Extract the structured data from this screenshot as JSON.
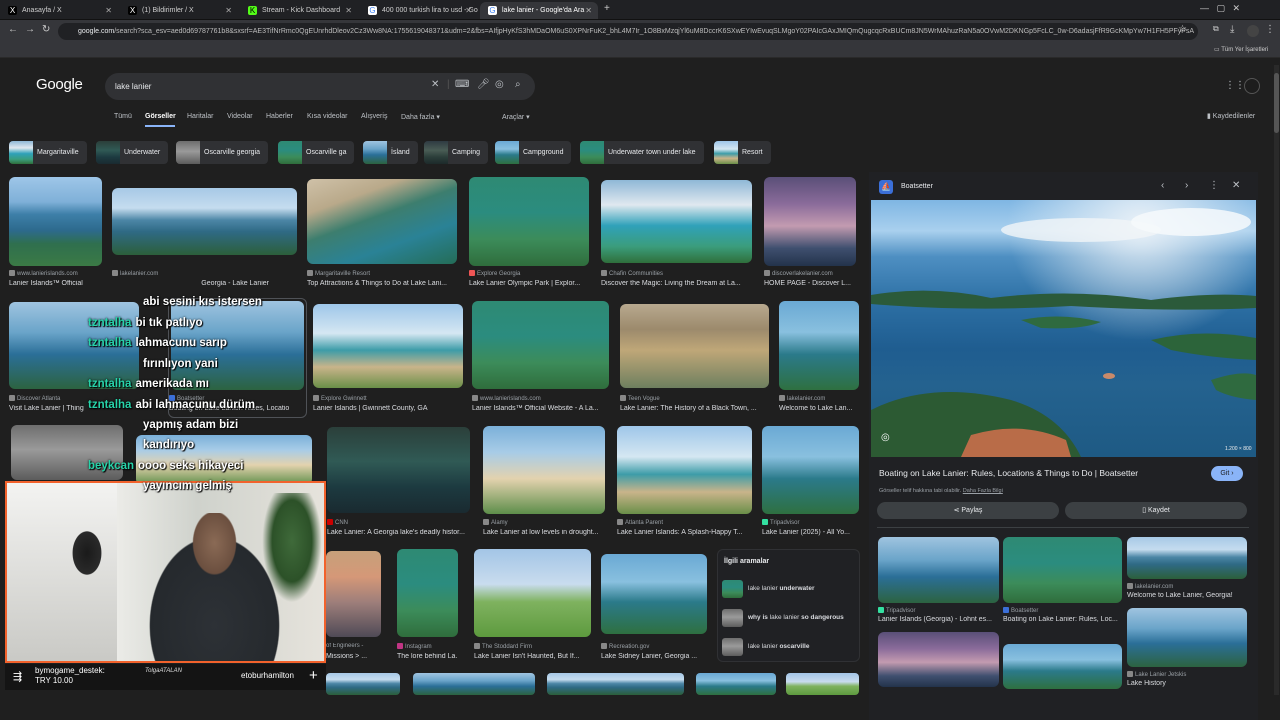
{
  "tabs": [
    {
      "label": "Anasayfa / X",
      "fav": "X",
      "fav_color": "#000000"
    },
    {
      "label": "(1) Bildirimler / X",
      "fav": "X",
      "fav_color": "#000000"
    },
    {
      "label": "Stream - Kick Dashboard",
      "fav": "K",
      "fav_color": "#53fc18"
    },
    {
      "label": "400 000 turkish lira to usd - Go",
      "fav": "G",
      "fav_color": "#4285f4"
    },
    {
      "label": "lake lanier - Google'da Ara",
      "fav": "G",
      "fav_color": "#4285f4"
    }
  ],
  "address": {
    "domain": "google.com",
    "path": "/search?sca_esv=aed0d69787761b8&sxsrf=AE3TifNrRmc0QgEUnrhdDleov2Cz3Ww8NA:1755619048371&udm=2&fbs=AIfjpHyKfS3hMDaOM6uS0XPNrFuK2_bhL4M7Ir_1O8BxMzqjYl6uM8DccrK6SXwEYIwEvuqSLMgoY02PAIcGAxJMIQmQugcqcRxBUCm8JN5WrMAhuzRaN5a0OVwM2DKNGp5FcLC_0w-D6adasjFfR9GcKMpYw7H1FH5PFyPsA",
    "bookmarks_label": "Tüm Yer İşaretleri"
  },
  "google": {
    "logo": "Google",
    "query": "lake lanier",
    "nav": [
      "Tümü",
      "Görseller",
      "Haritalar",
      "Videolar",
      "Haberler",
      "Kısa videolar",
      "Alışveriş",
      "Daha fazla"
    ],
    "tools": "Araçlar",
    "saved": "Kaydedilenler"
  },
  "chips": [
    "Margaritaville",
    "Underwater",
    "Oscarville georgia",
    "Oscarville ga",
    "İsland",
    "Camping",
    "Campground",
    "Underwater town under lake",
    "Resort"
  ],
  "results_row1": [
    {
      "src": "www.lanierislands.com",
      "title": "Lanier Islands™ Official"
    },
    {
      "src": "lakelanier.com",
      "title": "Georgia - Lake Lanier"
    },
    {
      "src": "Margaritaville Resort",
      "title": "Top Attractions & Things to Do at Lake Lani..."
    },
    {
      "src": "Explore Georgia",
      "title": "Lake Lanier Olympic Park | Explor..."
    },
    {
      "src": "Chafin Communities",
      "title": "Discover the Magic: Living the Dream at La..."
    },
    {
      "src": "discoverlakelanier.com",
      "title": "HOME PAGE - Discover L..."
    }
  ],
  "results_row2": [
    {
      "src": "Discover Atlanta",
      "title": "Visit Lake Lanier | Thing"
    },
    {
      "src": "Boatsetter",
      "title": "Boating on Lake Lanier: Rules, Locatio"
    },
    {
      "src": "Explore Gwinnett",
      "title": "Lanier Islands | Gwinnett County, GA"
    },
    {
      "src": "www.lanierislands.com",
      "title": "Lanier Islands™ Official Website - A La..."
    },
    {
      "src": "Teen Vogue",
      "title": "Lake Lanier: The History of a Black Town, ..."
    },
    {
      "src": "lakelanier.com",
      "title": "Welcome to Lake Lan..."
    }
  ],
  "results_row3": [
    {
      "src": "CNN",
      "title": "Lake Lanier: A Georgia lake's deadly histor..."
    },
    {
      "src": "Alamy",
      "title": "Lake Lanier at low levels in drought..."
    },
    {
      "src": "Atlanta Parent",
      "title": "Lake Lanier Islands: A Splash-Happy T..."
    },
    {
      "src": "Tripadvisor",
      "title": "Lake Lanier (2025) - All Yo..."
    }
  ],
  "results_row4": [
    {
      "src": "of Engineers -",
      "title": "Missions > ..."
    },
    {
      "src": "Instagram",
      "title": "The lore behind La..."
    },
    {
      "src": "The Stoddard Firm",
      "title": "Lake Lanier Isn't Haunted, But If..."
    },
    {
      "src": "Recreation.gov",
      "title": "Lake Sidney Lanier, Georgia ..."
    }
  ],
  "related": {
    "title": "İlgili aramalar",
    "items": [
      {
        "pre": "lake lanier ",
        "bold": "underwater"
      },
      {
        "pre": "why is ",
        "mid": "lake lanier",
        "bold": " so dangerous"
      },
      {
        "pre": "lake lanier ",
        "bold": "oscarville"
      }
    ]
  },
  "panel": {
    "source": "Boatsetter",
    "size": "1.200 × 800",
    "title": "Boating on Lake Lanier: Rules, Locations & Things to Do | Boatsetter",
    "note": "Görseller telif hakkına tabi olabilir.",
    "note_link": "Daha Fazla Bilgi",
    "visit": "Git",
    "share": "Paylaş",
    "save": "Kaydet",
    "related": [
      {
        "src": "Tripadvisor",
        "title": "Lanier Islands (Georgia) - Lohnt es..."
      },
      {
        "src": "Boatsetter",
        "title": "Boating on Lake Lanier: Rules, Loc..."
      },
      {
        "src": "lakelanier.com",
        "title": "Welcome to Lake Lanier, Georgia!"
      },
      {
        "src": "Lake Lanier Jetskis",
        "title": "Lake History"
      }
    ]
  },
  "stream": {
    "chat": [
      {
        "user": "",
        "msg": "abi sesini kıs istersen"
      },
      {
        "user": "tzntalha",
        "msg": "bi tık patlıyo"
      },
      {
        "user": "tzntalha",
        "msg": "lahmacunu sarıp"
      },
      {
        "user": "",
        "msg": "fırınlıyon yani"
      },
      {
        "user": "tzntalha",
        "msg": "amerikada mı"
      },
      {
        "user": "tzntalha",
        "msg": "abi lahmacunu dürüm"
      },
      {
        "user": "",
        "msg": "yapmış adam bizi"
      },
      {
        "user": "",
        "msg": "kandırıyo"
      },
      {
        "user": "beykcan",
        "msg": "oooo seks hikayeci"
      },
      {
        "user": "",
        "msg": "yayıncım gelmiş"
      }
    ],
    "donation_user": "bymogame_destek:",
    "donation_amount": "TRY 10.00",
    "donation_sig": "TolgaATALAN",
    "donation_name": "etoburhamilton"
  }
}
